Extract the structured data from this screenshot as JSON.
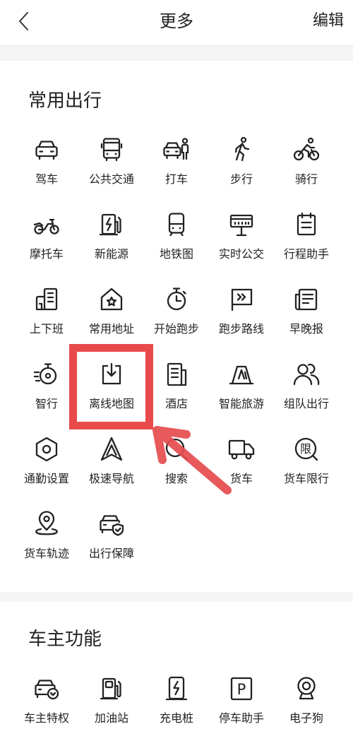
{
  "header": {
    "back_icon": "chevron-left-icon",
    "title": "更多",
    "edit_label": "编辑"
  },
  "sections": [
    {
      "title": "常用出行",
      "items": [
        {
          "label": "驾车",
          "icon": "car-icon"
        },
        {
          "label": "公共交通",
          "icon": "bus-icon"
        },
        {
          "label": "打车",
          "icon": "taxi-icon"
        },
        {
          "label": "步行",
          "icon": "walk-icon"
        },
        {
          "label": "骑行",
          "icon": "bike-icon"
        },
        {
          "label": "摩托车",
          "icon": "motorcycle-icon"
        },
        {
          "label": "新能源",
          "icon": "ev-charger-icon"
        },
        {
          "label": "地铁图",
          "icon": "metro-icon"
        },
        {
          "label": "实时公交",
          "icon": "bus-stop-icon"
        },
        {
          "label": "行程助手",
          "icon": "clipboard-icon"
        },
        {
          "label": "上下班",
          "icon": "office-building-icon"
        },
        {
          "label": "常用地址",
          "icon": "home-star-icon"
        },
        {
          "label": "开始跑步",
          "icon": "stopwatch-icon"
        },
        {
          "label": "跑步路线",
          "icon": "route-flag-icon"
        },
        {
          "label": "早晚报",
          "icon": "newspaper-icon"
        },
        {
          "label": "智行",
          "icon": "speed-timer-icon"
        },
        {
          "label": "离线地图",
          "icon": "download-box-icon"
        },
        {
          "label": "酒店",
          "icon": "hotel-icon"
        },
        {
          "label": "智能旅游",
          "icon": "mountain-icon"
        },
        {
          "label": "组队出行",
          "icon": "group-icon"
        },
        {
          "label": "通勤设置",
          "icon": "hexagon-settings-icon"
        },
        {
          "label": "极速导航",
          "icon": "navigation-arrow-icon"
        },
        {
          "label": "搜索",
          "icon": "search-icon"
        },
        {
          "label": "货车",
          "icon": "truck-icon"
        },
        {
          "label": "货车限行",
          "icon": "restriction-icon",
          "icon_text": "限"
        },
        {
          "label": "货车轨迹",
          "icon": "location-track-icon"
        },
        {
          "label": "出行保障",
          "icon": "car-shield-icon"
        }
      ]
    },
    {
      "title": "车主功能",
      "items": [
        {
          "label": "车主特权",
          "icon": "car-check-icon"
        },
        {
          "label": "加油站",
          "icon": "gas-pump-icon"
        },
        {
          "label": "充电桩",
          "icon": "charging-pile-icon"
        },
        {
          "label": "停车助手",
          "icon": "parking-icon",
          "icon_text": "P"
        },
        {
          "label": "电子狗",
          "icon": "camera-icon"
        }
      ]
    }
  ],
  "colors": {
    "text": "#222222",
    "separator_band": "#f5f5f5",
    "annotation_red": "#e84a4c"
  }
}
